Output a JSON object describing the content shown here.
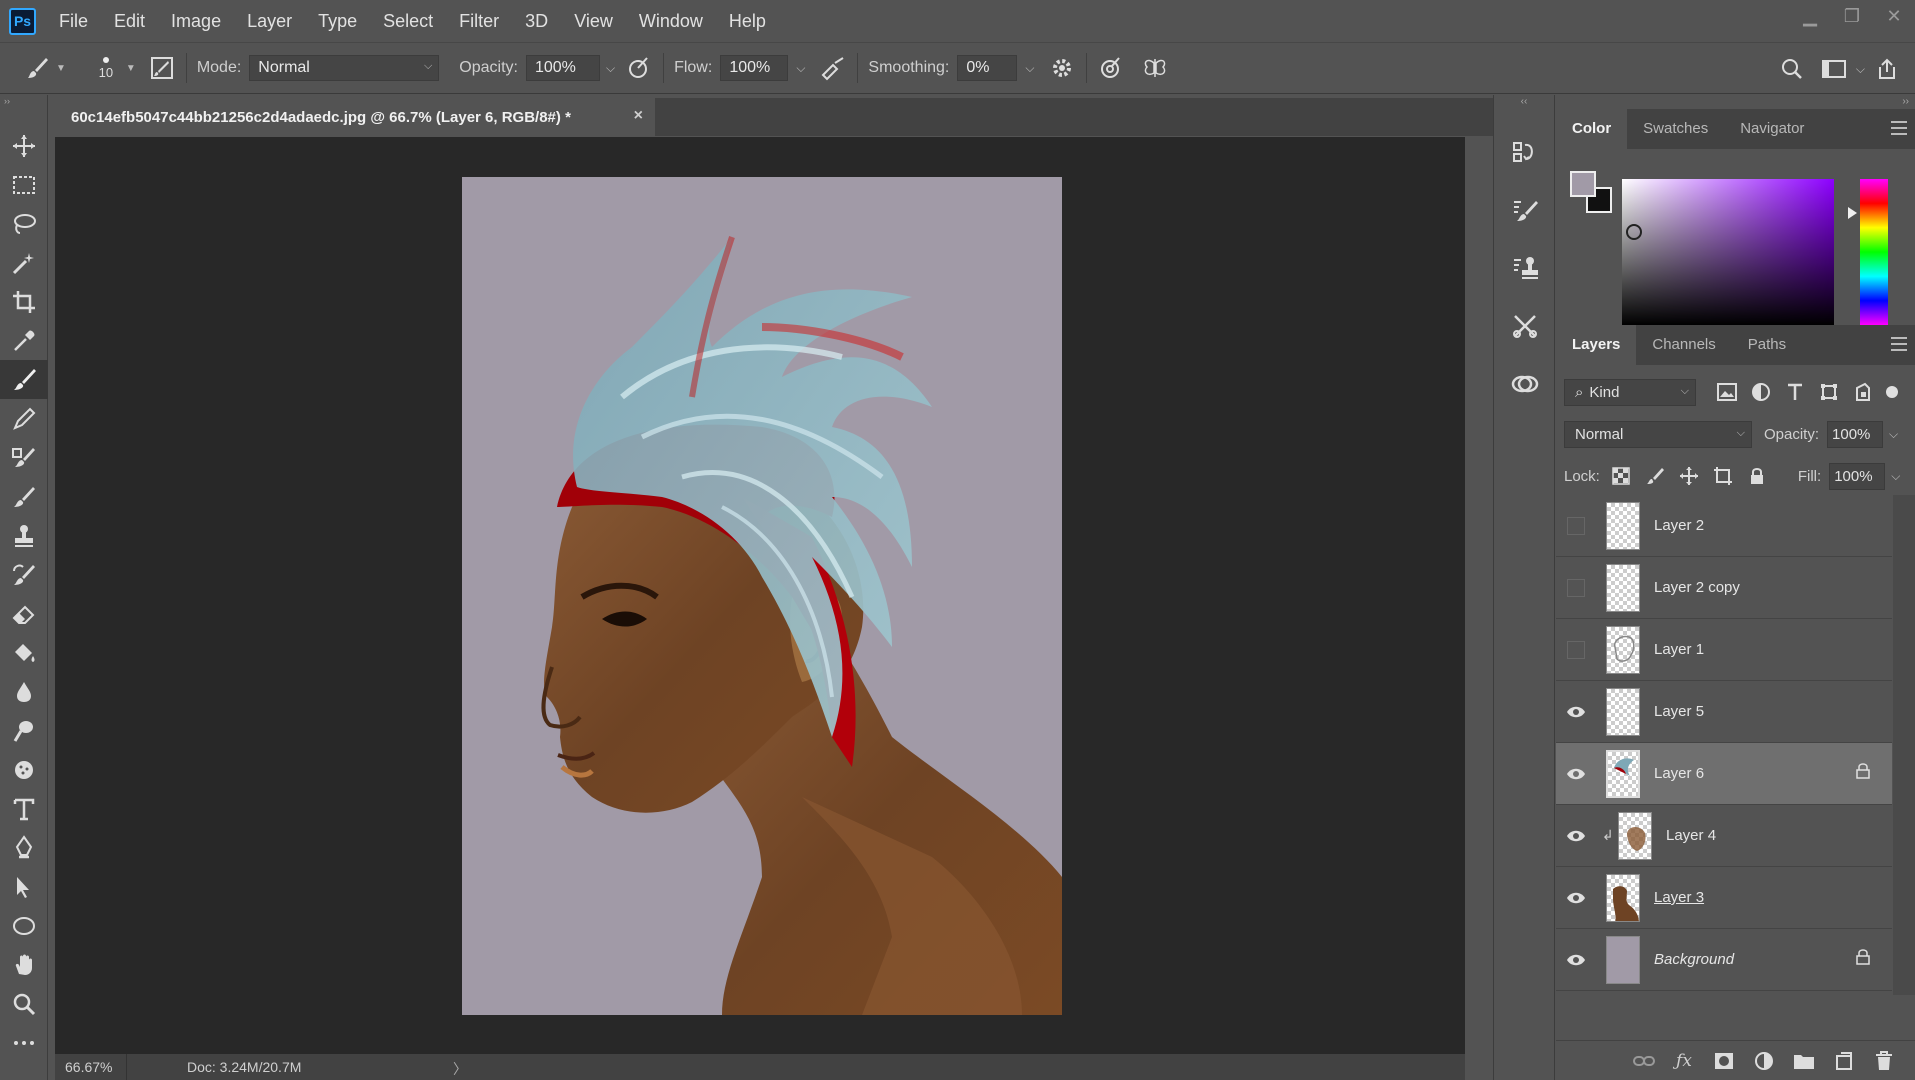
{
  "app": {
    "logo": "Ps",
    "menu": [
      "File",
      "Edit",
      "Image",
      "Layer",
      "Type",
      "Select",
      "Filter",
      "3D",
      "View",
      "Window",
      "Help"
    ],
    "window_controls": [
      "minimize-icon",
      "restore-icon",
      "close-icon"
    ]
  },
  "options": {
    "brush_size": "10",
    "mode_label": "Mode:",
    "mode_value": "Normal",
    "opacity_label": "Opacity:",
    "opacity_value": "100%",
    "flow_label": "Flow:",
    "flow_value": "100%",
    "smoothing_label": "Smoothing:",
    "smoothing_value": "0%"
  },
  "document": {
    "tab_title": "60c14efb5047c44bb21256c2d4adaedc.jpg @ 66.7% (Layer 6, RGB/8#) *",
    "close_glyph": "×",
    "zoom": "66.67%",
    "doc_size": "Doc: 3.24M/20.7M",
    "status_arrow": "〉",
    "canvas_bg": "#a19aa7"
  },
  "color_panel": {
    "tabs": [
      "Color",
      "Swatches",
      "Navigator"
    ],
    "foreground": "#a19aa7",
    "background": "#111111",
    "hue": "#8d00ff"
  },
  "layers_panel": {
    "tabs": [
      "Layers",
      "Channels",
      "Paths"
    ],
    "kind_label": "Kind",
    "blend_mode": "Normal",
    "opacity_label": "Opacity:",
    "opacity_value": "100%",
    "lock_label": "Lock:",
    "fill_label": "Fill:",
    "fill_value": "100%",
    "layers": [
      {
        "name": "Layer 2",
        "visible": false,
        "locked": false,
        "selected": false
      },
      {
        "name": "Layer 2 copy",
        "visible": false,
        "locked": false,
        "selected": false
      },
      {
        "name": "Layer 1",
        "visible": false,
        "locked": false,
        "selected": false
      },
      {
        "name": "Layer 5",
        "visible": true,
        "locked": false,
        "selected": false
      },
      {
        "name": "Layer 6",
        "visible": true,
        "locked": true,
        "selected": true
      },
      {
        "name": "Layer 4",
        "visible": true,
        "locked": false,
        "selected": false,
        "clipped": true
      },
      {
        "name": "Layer 3",
        "visible": true,
        "locked": false,
        "selected": false
      },
      {
        "name": "Background",
        "visible": true,
        "locked": true,
        "selected": false
      }
    ]
  }
}
